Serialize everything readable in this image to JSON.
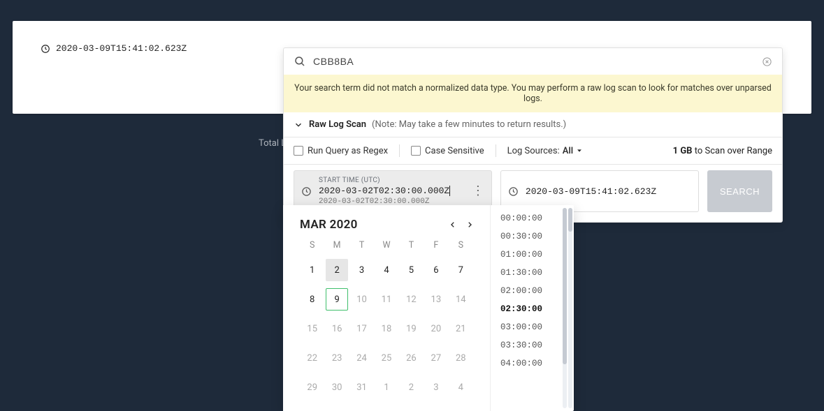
{
  "background": {
    "timestamp": "2020-03-09T15:41:02.623Z",
    "total_label_fragment": "Total L"
  },
  "search": {
    "icon": "search-icon",
    "value": "CBB8BA",
    "close_icon": "close-circle-icon",
    "notice": "Your search term did not match a normalized data type. You may perform a raw log scan to look for matches over unparsed logs.",
    "raw_log_scan_label": "Raw Log Scan",
    "raw_log_scan_note": "(Note: May take a few minutes to return results.)"
  },
  "options": {
    "regex_label": "Run Query as Regex",
    "regex_checked": false,
    "case_label": "Case Sensitive",
    "case_checked": false,
    "log_sources_label": "Log Sources:",
    "log_sources_value": "All",
    "scan_size": "1 GB",
    "scan_suffix": "to Scan over Range"
  },
  "date_range": {
    "start": {
      "label": "START TIME (UTC)",
      "value": "2020-03-02T02:30:00.000Z",
      "parsed": "2020-03-02T02:30:00.000Z"
    },
    "end": {
      "value": "2020-03-09T15:41:02.623Z"
    },
    "search_button": "SEARCH"
  },
  "calendar": {
    "title": "MAR 2020",
    "dow": [
      "S",
      "M",
      "T",
      "W",
      "T",
      "F",
      "S"
    ],
    "weeks": [
      [
        {
          "n": 1
        },
        {
          "n": 2,
          "sel": true
        },
        {
          "n": 3
        },
        {
          "n": 4
        },
        {
          "n": 5
        },
        {
          "n": 6
        },
        {
          "n": 7
        }
      ],
      [
        {
          "n": 8
        },
        {
          "n": 9,
          "today": true
        },
        {
          "n": 10,
          "m": true
        },
        {
          "n": 11,
          "m": true
        },
        {
          "n": 12,
          "m": true
        },
        {
          "n": 13,
          "m": true
        },
        {
          "n": 14,
          "m": true
        }
      ],
      [
        {
          "n": 15,
          "m": true
        },
        {
          "n": 16,
          "m": true
        },
        {
          "n": 17,
          "m": true
        },
        {
          "n": 18,
          "m": true
        },
        {
          "n": 19,
          "m": true
        },
        {
          "n": 20,
          "m": true
        },
        {
          "n": 21,
          "m": true
        }
      ],
      [
        {
          "n": 22,
          "m": true
        },
        {
          "n": 23,
          "m": true
        },
        {
          "n": 24,
          "m": true
        },
        {
          "n": 25,
          "m": true
        },
        {
          "n": 26,
          "m": true
        },
        {
          "n": 27,
          "m": true
        },
        {
          "n": 28,
          "m": true
        }
      ],
      [
        {
          "n": 29,
          "m": true
        },
        {
          "n": 30,
          "m": true
        },
        {
          "n": 31,
          "m": true
        },
        {
          "n": 1,
          "m": true
        },
        {
          "n": 2,
          "m": true
        },
        {
          "n": 3,
          "m": true
        },
        {
          "n": 4,
          "m": true
        }
      ]
    ],
    "times": [
      {
        "t": "00:00:00"
      },
      {
        "t": "00:30:00"
      },
      {
        "t": "01:00:00"
      },
      {
        "t": "01:30:00"
      },
      {
        "t": "02:00:00"
      },
      {
        "t": "02:30:00",
        "sel": true
      },
      {
        "t": "03:00:00"
      },
      {
        "t": "03:30:00"
      },
      {
        "t": "04:00:00"
      }
    ]
  }
}
